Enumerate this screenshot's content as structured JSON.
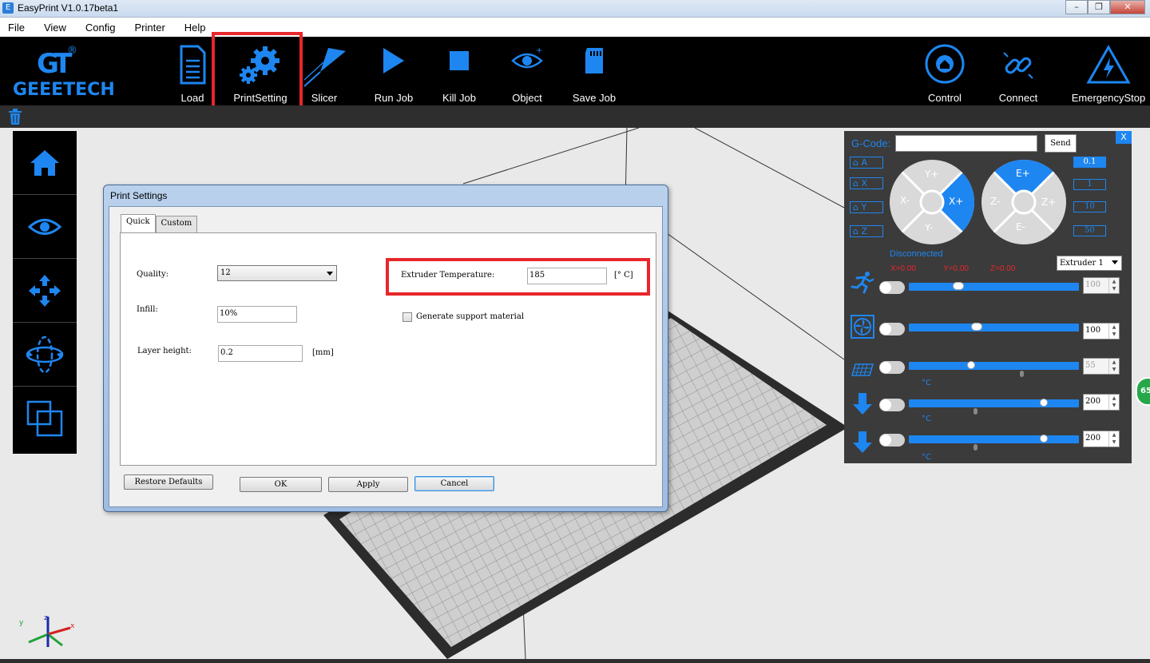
{
  "window": {
    "title": "EasyPrint  V1.0.17beta1"
  },
  "menu": [
    "File",
    "View",
    "Config",
    "Printer",
    "Help"
  ],
  "brand": {
    "mark": "GT",
    "reg": "®",
    "name": "GEEETECH"
  },
  "toolbar": {
    "load": "Load",
    "print_setting": "PrintSetting",
    "slicer": "Slicer",
    "run_job": "Run Job",
    "kill_job": "Kill Job",
    "object": "Object",
    "save_job": "Save Job",
    "control": "Control",
    "connect": "Connect",
    "emergency_stop": "EmergencyStop"
  },
  "dialog": {
    "title": "Print Settings",
    "tabs": [
      "Quick",
      "Custom"
    ],
    "quality_label": "Quality:",
    "quality_value": "12",
    "infill_label": "Infill:",
    "infill_value": "10%",
    "layer_height_label": "Layer height:",
    "layer_height_value": "0.2",
    "layer_height_unit": "[mm]",
    "extruder_temp_label": "Extruder Temperature:",
    "extruder_temp_value": "185",
    "extruder_temp_unit": "[° C]",
    "support_label": "Generate support material",
    "support_checked": false,
    "restore_defaults": "Restore Defaults",
    "ok": "OK",
    "apply": "Apply",
    "cancel": "Cancel"
  },
  "control_panel": {
    "close": "X",
    "gcode_label": "G-Code:",
    "gcode_value": "",
    "send": "Send",
    "home_buttons": [
      "A",
      "X",
      "Y",
      "Z"
    ],
    "xy_pad": {
      "y_plus": "Y+",
      "y_minus": "Y-",
      "x_plus": "X+",
      "x_minus": "X-"
    },
    "ze_pad": {
      "e_plus": "E+",
      "e_minus": "E-",
      "z_plus": "Z+",
      "z_minus": "Z-"
    },
    "steps": [
      "0.1",
      "1",
      "10",
      "50"
    ],
    "selected_step": "0.1",
    "status": "Disconnected",
    "coords": {
      "x": "X=0.00",
      "y": "Y=0.00",
      "z": "Z=0.00"
    },
    "extruder_select": "Extruder 1",
    "rows": [
      {
        "name": "speed",
        "value": "100",
        "disabled": true,
        "unit": ""
      },
      {
        "name": "fan",
        "value": "100",
        "disabled": false,
        "unit": ""
      },
      {
        "name": "bed",
        "value": "55",
        "disabled": true,
        "unit": "°C"
      },
      {
        "name": "extruder1",
        "value": "200",
        "disabled": false,
        "unit": "°C"
      },
      {
        "name": "extruder2",
        "value": "200",
        "disabled": false,
        "unit": "°C"
      }
    ]
  },
  "side_badge": "65",
  "colors": {
    "accent": "#1e86f0",
    "highlight": "#e8262b",
    "toolbar_bg": "#000000",
    "panel_bg": "#3b3b3b"
  }
}
